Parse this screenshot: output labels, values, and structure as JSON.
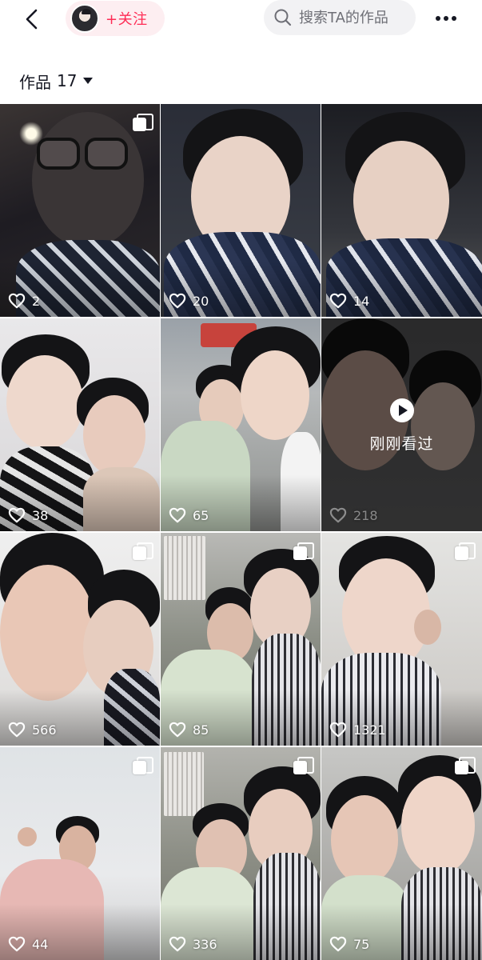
{
  "topbar": {
    "follow_label": "+关注",
    "search_placeholder": "搜索TA的作品"
  },
  "works": {
    "label": "作品",
    "count": "17"
  },
  "grid": {
    "items": [
      {
        "likes": "2",
        "multi_image": true,
        "recently_viewed": false
      },
      {
        "likes": "20",
        "multi_image": false,
        "recently_viewed": false
      },
      {
        "likes": "14",
        "multi_image": false,
        "recently_viewed": false
      },
      {
        "likes": "38",
        "multi_image": false,
        "recently_viewed": false
      },
      {
        "likes": "65",
        "multi_image": false,
        "recently_viewed": false
      },
      {
        "likes": "218",
        "multi_image": false,
        "recently_viewed": true,
        "recent_label": "刚刚看过"
      },
      {
        "likes": "566",
        "multi_image": true,
        "recently_viewed": false
      },
      {
        "likes": "85",
        "multi_image": true,
        "recently_viewed": false
      },
      {
        "likes": "1321",
        "multi_image": true,
        "recently_viewed": false
      },
      {
        "likes": "44",
        "multi_image": true,
        "recently_viewed": false
      },
      {
        "likes": "336",
        "multi_image": true,
        "recently_viewed": false
      },
      {
        "likes": "75",
        "multi_image": true,
        "recently_viewed": false
      }
    ]
  },
  "colors": {
    "accent": "#fe2c55",
    "follow_pill_bg": "#fdeef1",
    "search_bg": "#f2f2f4"
  },
  "icons": [
    "back-arrow-icon",
    "search-icon",
    "more-dots-icon",
    "heart-icon",
    "multi-image-icon",
    "play-icon"
  ]
}
